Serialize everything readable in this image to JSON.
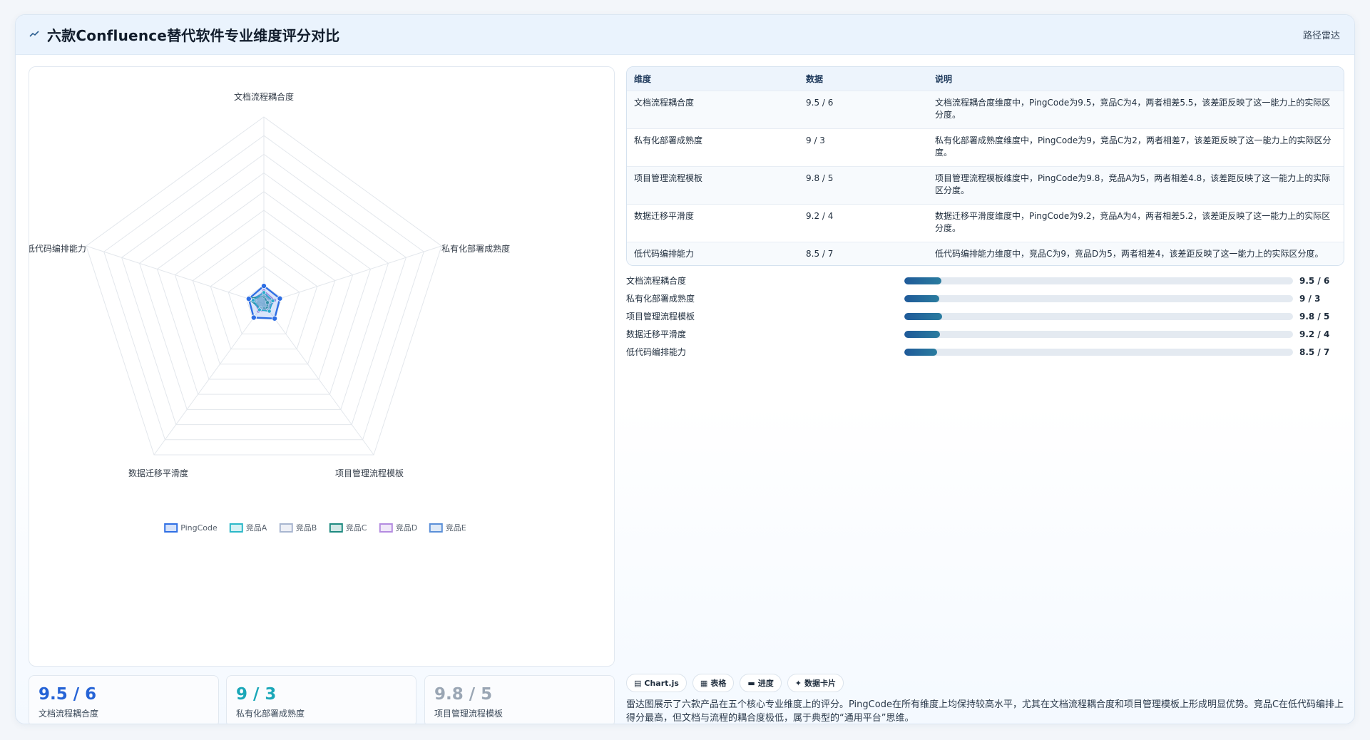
{
  "header": {
    "title": "六款Confluence替代软件专业维度评分对比",
    "tag": "路径雷达"
  },
  "colors": {
    "PingCode": "#2f6fe4",
    "竞品A": "#2bb8c8",
    "竞品B": "#a8b6d0",
    "竞品C": "#1e8a80",
    "竞品D": "#b48be0",
    "竞品E": "#5a8fd8"
  },
  "chart_data": {
    "type": "radar",
    "axes": [
      "文档流程耦合度",
      "私有化部署成熟度",
      "项目管理流程模板",
      "数据迁移平滑度",
      "低代码编排能力"
    ],
    "rlim": [
      0,
      100
    ],
    "rings": 10,
    "series": [
      {
        "name": "PingCode",
        "values": [
          9.5,
          9,
          9.8,
          9.2,
          8.5
        ]
      },
      {
        "name": "竞品A",
        "values": [
          6,
          5,
          5,
          4,
          6
        ]
      },
      {
        "name": "竞品B",
        "values": [
          5,
          4,
          4,
          3,
          5
        ]
      },
      {
        "name": "竞品C",
        "values": [
          4,
          2,
          3,
          3,
          9
        ]
      },
      {
        "name": "竞品D",
        "values": [
          7,
          6,
          4,
          5,
          5
        ]
      },
      {
        "name": "竞品E",
        "values": [
          6,
          4,
          5,
          4,
          7
        ]
      }
    ],
    "legend_position": "bottom"
  },
  "stats": [
    {
      "value": "9.5 / 6",
      "label": "文档流程耦合度",
      "color": "#2563d6"
    },
    {
      "value": "9 / 3",
      "label": "私有化部署成熟度",
      "color": "#1aa7b8"
    },
    {
      "value": "9.8 / 5",
      "label": "项目管理流程模板",
      "color": "#9aa6b4"
    }
  ],
  "table": {
    "headers": [
      "维度",
      "数据",
      "说明"
    ],
    "rows": [
      {
        "dim": "文档流程耦合度",
        "data": "9.5 / 6",
        "desc": "文档流程耦合度维度中，PingCode为9.5，竞品C为4，两者相差5.5，该差距反映了这一能力上的实际区分度。"
      },
      {
        "dim": "私有化部署成熟度",
        "data": "9 / 3",
        "desc": "私有化部署成熟度维度中，PingCode为9，竞品C为2，两者相差7，该差距反映了这一能力上的实际区分度。"
      },
      {
        "dim": "项目管理流程模板",
        "data": "9.8 / 5",
        "desc": "项目管理流程模板维度中，PingCode为9.8，竞品A为5，两者相差4.8，该差距反映了这一能力上的实际区分度。"
      },
      {
        "dim": "数据迁移平滑度",
        "data": "9.2 / 4",
        "desc": "数据迁移平滑度维度中，PingCode为9.2，竞品A为4，两者相差5.2，该差距反映了这一能力上的实际区分度。"
      },
      {
        "dim": "低代码编排能力",
        "data": "8.5 / 7",
        "desc": "低代码编排能力维度中，竞品C为9，竞品D为5，两者相差4，该差距反映了这一能力上的实际区分度。"
      }
    ]
  },
  "progress": [
    {
      "label": "文档流程耦合度",
      "value": "9.5 / 6",
      "fraction": 0.095
    },
    {
      "label": "私有化部署成熟度",
      "value": "9 / 3",
      "fraction": 0.09
    },
    {
      "label": "项目管理流程模板",
      "value": "9.8 / 5",
      "fraction": 0.098
    },
    {
      "label": "数据迁移平滑度",
      "value": "9.2 / 4",
      "fraction": 0.092
    },
    {
      "label": "低代码编排能力",
      "value": "8.5 / 7",
      "fraction": 0.085
    }
  ],
  "chips": [
    {
      "icon": "chart-icon",
      "glyph": "▤",
      "label": "Chart.js"
    },
    {
      "icon": "table-icon",
      "glyph": "▦",
      "label": "表格"
    },
    {
      "icon": "progress-icon",
      "glyph": "▬",
      "label": "进度"
    },
    {
      "icon": "sparkle-icon",
      "glyph": "✦",
      "label": "数据卡片"
    }
  ],
  "summary": "雷达图展示了六款产品在五个核心专业维度上的评分。PingCode在所有维度上均保持较高水平，尤其在文档流程耦合度和项目管理模板上形成明显优势。竞品C在低代码编排上得分最高，但文档与流程的耦合度极低，属于典型的“通用平台”思维。"
}
